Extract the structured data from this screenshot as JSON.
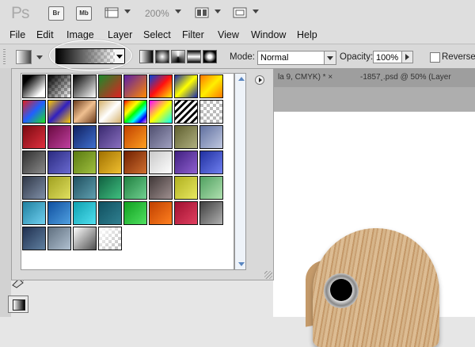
{
  "app": {
    "logo": "Ps",
    "bridge": "Br",
    "minibridge": "Mb",
    "zoom": "200%"
  },
  "menu": [
    "File",
    "Edit",
    "Image",
    "Layer",
    "Select",
    "Filter",
    "View",
    "Window",
    "Help"
  ],
  "options": {
    "mode_label": "Mode:",
    "mode_value": "Normal",
    "opacity_label": "Opacity:",
    "opacity_value": "100%",
    "reverse_label": "Reverse"
  },
  "tabs": [
    "la 9, CMYK) * ×",
    "-1857¸.psd @ 50% (Layer"
  ],
  "swatches": [
    [
      "linear-gradient(135deg,#000 20%,#fff 80%)",
      "check-black",
      "linear-gradient(135deg,#000,#fff)",
      "linear-gradient(135deg,#1a8a2a,#e02020)",
      "linear-gradient(135deg,#5a1ea8,#ff8800)",
      "linear-gradient(135deg,#0044dd,#ff1010,#ffee00)",
      "linear-gradient(135deg,#1a2aaa,#ffff00,#1a2aaa)",
      "linear-gradient(135deg,#ff7700,#ffee00,#ff7700)"
    ],
    [
      "linear-gradient(135deg,#e02020,#2060ff,#20e020)",
      "linear-gradient(135deg,#ffcc00,#3020c0,#ffcc00)",
      "linear-gradient(135deg,#6a3a1a,#f0c090,#6a3a1a)",
      "linear-gradient(135deg,#d4b06a,#fff,#d4b06a)",
      "linear-gradient(135deg,red,orange,yellow,lime,cyan,blue,violet)",
      "linear-gradient(135deg,#ff00ff,#ffff00,#00ffff)",
      "stripes",
      "check"
    ],
    [
      "linear-gradient(135deg,#7a0a10,#e03040)",
      "linear-gradient(135deg,#6a0a40,#c040a0)",
      "linear-gradient(135deg,#102060,#4070d0)",
      "linear-gradient(135deg,#3a2a70,#8a70c0)",
      "linear-gradient(135deg,#c04000,#ffa020)",
      "linear-gradient(135deg,#505070,#a0a0c0)",
      "linear-gradient(135deg,#606030,#b0b080)",
      "linear-gradient(135deg,#6070a0,#c0c8e0)"
    ],
    [
      "linear-gradient(135deg,#303030,#8a8a8a)",
      "linear-gradient(135deg,#2a2a80,#6a6ad0)",
      "linear-gradient(135deg,#5a7a10,#a0c040)",
      "linear-gradient(135deg,#a07000,#f0c030)",
      "linear-gradient(135deg,#702000,#d07030)",
      "linear-gradient(135deg,#c8c8c8,#fff)",
      "linear-gradient(135deg,#402080,#9060d0)",
      "linear-gradient(135deg,#2030a0,#7080f0)"
    ],
    [
      "linear-gradient(135deg,#303848,#8090a8)",
      "linear-gradient(135deg,#a0a020,#e0e060)",
      "linear-gradient(135deg,#205060,#60a0b0)",
      "linear-gradient(135deg,#106040,#40c080)",
      "linear-gradient(135deg,#208040,#70d090)",
      "linear-gradient(135deg,#403838,#a09090)",
      "linear-gradient(135deg,#b0b020,#e8e860)",
      "linear-gradient(135deg,#50a060,#b0e0b0)"
    ],
    [
      "linear-gradient(135deg,#2080a0,#70d0f0)",
      "linear-gradient(135deg,#1050a0,#50a0e0)",
      "linear-gradient(135deg,#10a0b0,#50e0f0)",
      "linear-gradient(135deg,#105060,#308090)",
      "linear-gradient(135deg,#10a020,#50e060)",
      "linear-gradient(135deg,#c04000,#ff8020)",
      "linear-gradient(135deg,#a01030,#e04060)",
      "linear-gradient(135deg,#404040,#b0b0b0)"
    ],
    [
      "linear-gradient(135deg,#203050,#6080a0)",
      "linear-gradient(135deg,#607080,#b0c0d0)",
      "linear-gradient(135deg,#fff,#505050)",
      "check-white"
    ]
  ]
}
